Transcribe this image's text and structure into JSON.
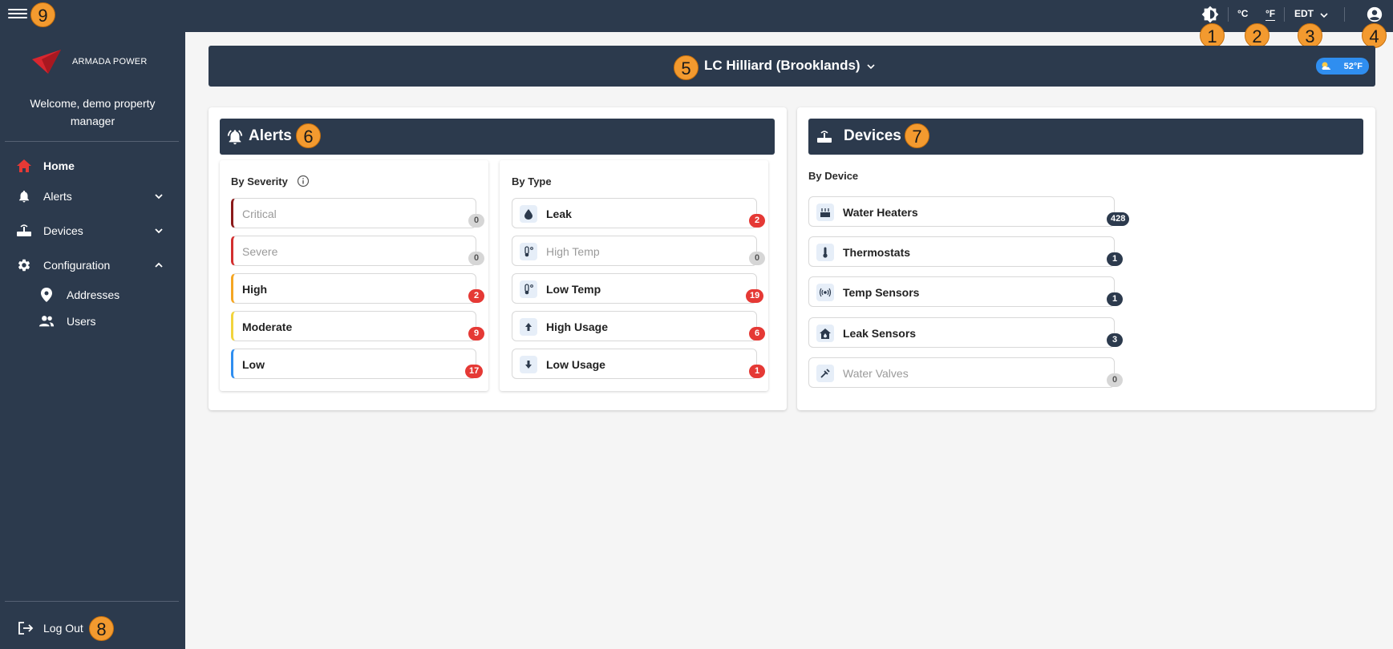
{
  "markers": {
    "m1": "1",
    "m2": "2",
    "m3": "3",
    "m4": "4",
    "m5": "5",
    "m6": "6",
    "m7": "7",
    "m8": "8",
    "m9": "9"
  },
  "topbar": {
    "unit_c": "°C",
    "unit_f": "°F",
    "timezone": "EDT"
  },
  "sidebar": {
    "brand": "ARMADA POWER",
    "welcome": "Welcome, demo property manager",
    "items": [
      {
        "label": "Home",
        "icon": "home-icon"
      },
      {
        "label": "Alerts",
        "icon": "bell-icon"
      },
      {
        "label": "Devices",
        "icon": "router-icon"
      },
      {
        "label": "Configuration",
        "icon": "gear-icon"
      },
      {
        "label": "Addresses",
        "icon": "map-pin-icon"
      },
      {
        "label": "Users",
        "icon": "users-icon"
      }
    ],
    "logout": "Log Out"
  },
  "property": {
    "name": "LC Hilliard (Brooklands)",
    "weather": "52°F"
  },
  "alerts": {
    "title": "Alerts",
    "by_severity": {
      "title": "By Severity",
      "items": [
        {
          "label": "Critical",
          "count": "0",
          "color": "#8b1a1a"
        },
        {
          "label": "Severe",
          "count": "0",
          "color": "#d32f2f"
        },
        {
          "label": "High",
          "count": "2",
          "color": "#f5a623"
        },
        {
          "label": "Moderate",
          "count": "9",
          "color": "#f2d43d"
        },
        {
          "label": "Low",
          "count": "17",
          "color": "#2f8ef0"
        }
      ]
    },
    "by_type": {
      "title": "By Type",
      "items": [
        {
          "label": "Leak",
          "count": "2",
          "icon": "water-drop-icon"
        },
        {
          "label": "High Temp",
          "count": "0",
          "icon": "thermometer-high-icon"
        },
        {
          "label": "Low Temp",
          "count": "19",
          "icon": "thermometer-low-icon"
        },
        {
          "label": "High Usage",
          "count": "6",
          "icon": "arrow-up-icon"
        },
        {
          "label": "Low Usage",
          "count": "1",
          "icon": "arrow-down-icon"
        }
      ]
    }
  },
  "devices": {
    "title": "Devices",
    "by_device": {
      "title": "By Device",
      "items": [
        {
          "label": "Water Heaters",
          "count": "428",
          "icon": "water-heater-icon"
        },
        {
          "label": "Thermostats",
          "count": "1",
          "icon": "thermometer-icon"
        },
        {
          "label": "Temp Sensors",
          "count": "1",
          "icon": "sensor-icon"
        },
        {
          "label": "Leak Sensors",
          "count": "3",
          "icon": "house-leak-icon"
        },
        {
          "label": "Water Valves",
          "count": "0",
          "icon": "valve-icon"
        }
      ]
    }
  }
}
